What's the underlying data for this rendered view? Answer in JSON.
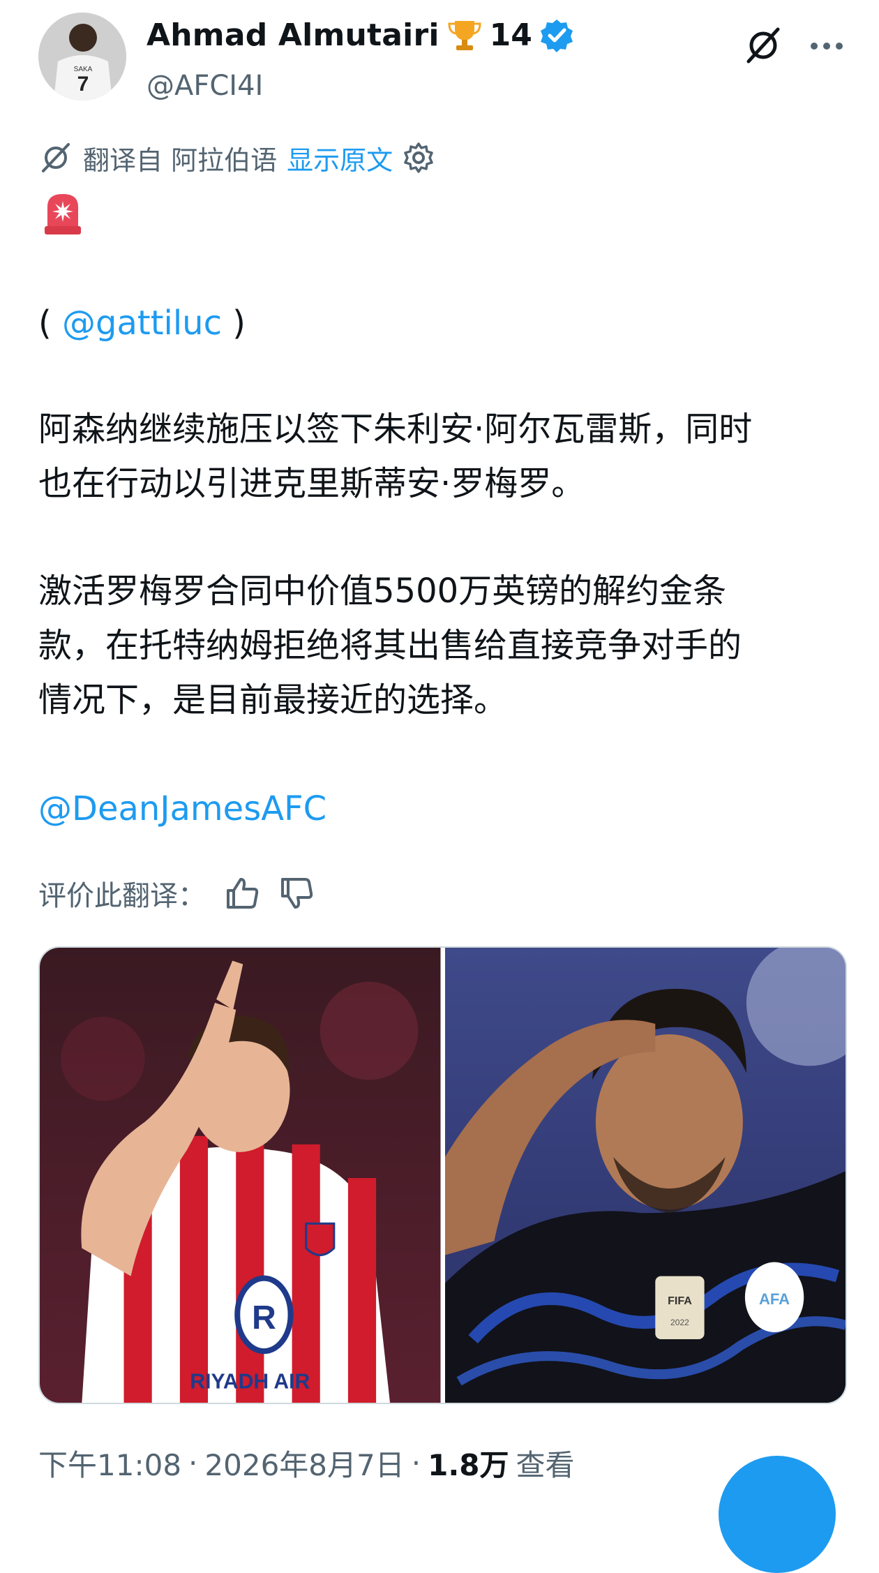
{
  "author": {
    "display_name": "Ahmad Almutairi",
    "badge_count": "14",
    "handle": "@AFCI4I",
    "avatar_jersey_name": "SAKA",
    "avatar_jersey_number": "7"
  },
  "translation": {
    "label": "翻译自 阿拉伯语",
    "show_original": "显示原文"
  },
  "tweet": {
    "open_paren": "( ",
    "source_mention": "@gattiluc",
    "close_paren": " )",
    "paragraph1_line1": "阿森纳继续施压以签下朱利安·阿尔瓦雷斯，同时",
    "paragraph1_line2": "也在行动以引进克里斯蒂安·罗梅罗。",
    "paragraph2_line1": "激活罗梅罗合同中价值5500万英镑的解约金条",
    "paragraph2_line2": "款，在托特纳姆拒绝将其出售给直接竞争对手的",
    "paragraph2_line3": "情况下，是目前最接近的选择。",
    "credit_mention": "@DeanJamesAFC"
  },
  "rating": {
    "label": "评价此翻译："
  },
  "media": {
    "left_photo_sponsor": "RIYADH AIR",
    "right_photo_badge": "FIFA",
    "right_photo_crest": "AFA",
    "right_photo_year": "2022"
  },
  "meta": {
    "time": "下午11:08",
    "sep1": "·",
    "date": "2026年8月7日",
    "sep2": "·",
    "views_count": "1.8万",
    "views_label": "查看"
  },
  "colors": {
    "accent": "#1d9bf0",
    "secondary_text": "#536471",
    "primary_text": "#0f1419",
    "verified": "#1d9bf0",
    "trophy": "#f4a623"
  },
  "icons": [
    "grok-icon",
    "more-icon",
    "trophy-icon",
    "verified-icon",
    "settings-icon",
    "siren-icon",
    "thumbs-up-icon",
    "thumbs-down-icon"
  ]
}
